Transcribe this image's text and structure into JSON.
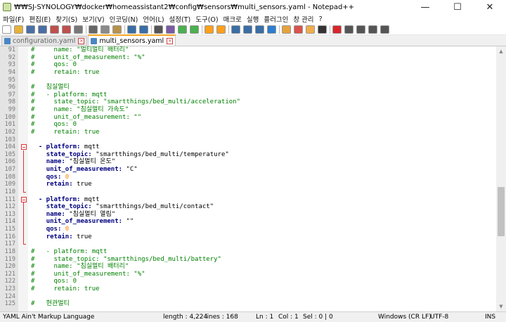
{
  "window": {
    "title": "₩₩SJ-SYNOLOGY₩docker₩homeassistant2₩config₩sensors₩multi_sensors.yaml - Notepad++",
    "minimize": "—",
    "maximize": "☐",
    "close": "✕"
  },
  "menu": [
    "파일(F)",
    "편집(E)",
    "찾기(S)",
    "보기(V)",
    "인코딩(N)",
    "언어(L)",
    "설정(T)",
    "도구(O)",
    "매크로",
    "실행",
    "플러그인",
    "창 관리",
    "?"
  ],
  "toolbar_icons": [
    {
      "name": "new-file-icon",
      "color": "#ffffff"
    },
    {
      "name": "open-file-icon",
      "color": "#e7b23a"
    },
    {
      "name": "save-icon",
      "color": "#4a6fa5"
    },
    {
      "name": "save-all-icon",
      "color": "#4a6fa5"
    },
    {
      "name": "close-icon",
      "color": "#c0504d"
    },
    {
      "name": "close-all-icon",
      "color": "#c0504d"
    },
    {
      "name": "print-icon",
      "color": "#777777"
    },
    {
      "name": "cut-icon",
      "color": "#666666"
    },
    {
      "name": "copy-icon",
      "color": "#8a8a8a"
    },
    {
      "name": "paste-icon",
      "color": "#b8924a"
    },
    {
      "name": "undo-icon",
      "color": "#3a6ea5"
    },
    {
      "name": "redo-icon",
      "color": "#3a6ea5"
    },
    {
      "name": "find-icon",
      "color": "#555555"
    },
    {
      "name": "replace-icon",
      "color": "#7a5aa5"
    },
    {
      "name": "zoom-in-icon",
      "color": "#4caf50"
    },
    {
      "name": "zoom-out-icon",
      "color": "#4caf50"
    },
    {
      "name": "sync-v-icon",
      "color": "#ff9f1a"
    },
    {
      "name": "sync-h-icon",
      "color": "#ff9f1a"
    },
    {
      "name": "word-wrap-icon",
      "color": "#3a6ea5"
    },
    {
      "name": "show-all-chars-icon",
      "color": "#3a6ea5"
    },
    {
      "name": "indent-guide-icon",
      "color": "#3a6ea5"
    },
    {
      "name": "udl-icon",
      "color": "#2f7dd1"
    },
    {
      "name": "doc-map-icon",
      "color": "#e6a23c"
    },
    {
      "name": "function-list-icon",
      "color": "#d9534f"
    },
    {
      "name": "folder-workspace-icon",
      "color": "#f0ad4e"
    },
    {
      "name": "monitor-icon",
      "color": "#333333"
    },
    {
      "name": "record-macro-icon",
      "color": "#d9252a"
    },
    {
      "name": "stop-macro-icon",
      "color": "#555555"
    },
    {
      "name": "play-macro-icon",
      "color": "#555555"
    },
    {
      "name": "play-multi-icon",
      "color": "#555555"
    },
    {
      "name": "save-macro-icon",
      "color": "#555555"
    }
  ],
  "tabs": [
    {
      "label": "configuration.yaml",
      "active": false,
      "save_color": "#4a86c5"
    },
    {
      "label": "multi_sensors.yaml",
      "active": true,
      "save_color": "#4a86c5"
    }
  ],
  "editor": {
    "lines": [
      {
        "n": "91",
        "fold": "",
        "html": "<span class='cm'>#     name: \"멀티멀티 배터리\"</span>"
      },
      {
        "n": "92",
        "fold": "",
        "html": "<span class='cm'>#     unit_of_measurement: \"%\"</span>"
      },
      {
        "n": "93",
        "fold": "",
        "html": "<span class='cm'>#     qos: 0</span>"
      },
      {
        "n": "94",
        "fold": "",
        "html": "<span class='cm'>#     retain: true</span>"
      },
      {
        "n": "95",
        "fold": "",
        "html": ""
      },
      {
        "n": "96",
        "fold": "",
        "html": "<span class='cm'>#   침실멀티</span>"
      },
      {
        "n": "97",
        "fold": "",
        "html": "<span class='cm'>#   - platform: mqtt</span>"
      },
      {
        "n": "98",
        "fold": "",
        "html": "<span class='cm'>#     state_topic: \"smartthings/bed_multi/acceleration\"</span>"
      },
      {
        "n": "99",
        "fold": "",
        "html": "<span class='cm'>#     name: \"침실멀티 가속도\"</span>"
      },
      {
        "n": "100",
        "fold": "",
        "html": "<span class='cm'>#     unit_of_measurement: \"\"</span>"
      },
      {
        "n": "101",
        "fold": "",
        "html": "<span class='cm'>#     qos: 0</span>"
      },
      {
        "n": "102",
        "fold": "",
        "html": "<span class='cm'>#     retain: true</span>"
      },
      {
        "n": "103",
        "fold": "",
        "html": ""
      },
      {
        "n": "104",
        "fold": "box",
        "html": "  <span class='ky'>- platform:</span> <span class='st'>mqtt</span>"
      },
      {
        "n": "105",
        "fold": "bar",
        "html": "    <span class='ky'>state_topic:</span> <span class='st'>\"smartthings/bed_multi/temperature\"</span>"
      },
      {
        "n": "106",
        "fold": "bar",
        "html": "    <span class='ky'>name:</span> <span class='st'>\"침실멀티 온도\"</span>"
      },
      {
        "n": "107",
        "fold": "bar",
        "html": "    <span class='ky'>unit_of_measurement:</span> <span class='st'>\"C\"</span>"
      },
      {
        "n": "108",
        "fold": "bar",
        "html": "    <span class='ky'>qos:</span> <span class='nm'>0</span>"
      },
      {
        "n": "109",
        "fold": "bar",
        "html": "    <span class='ky'>retain:</span> <span class='st'>true</span>"
      },
      {
        "n": "110",
        "fold": "end",
        "html": ""
      },
      {
        "n": "111",
        "fold": "box",
        "html": "  <span class='ky'>- platform:</span> <span class='st'>mqtt</span>"
      },
      {
        "n": "112",
        "fold": "bar",
        "html": "    <span class='ky'>state_topic:</span> <span class='st'>\"smartthings/bed_multi/contact\"</span>"
      },
      {
        "n": "113",
        "fold": "bar",
        "html": "    <span class='ky'>name:</span> <span class='st'>\"침실멀티 열림\"</span>"
      },
      {
        "n": "114",
        "fold": "bar",
        "html": "    <span class='ky'>unit_of_measurement:</span> <span class='st'>\"\"</span>"
      },
      {
        "n": "115",
        "fold": "bar",
        "html": "    <span class='ky'>qos:</span> <span class='nm'>0</span>"
      },
      {
        "n": "116",
        "fold": "bar",
        "html": "    <span class='ky'>retain:</span> <span class='st'>true</span>"
      },
      {
        "n": "117",
        "fold": "end",
        "html": ""
      },
      {
        "n": "118",
        "fold": "",
        "html": "<span class='cm'>#   - platform: mqtt</span>"
      },
      {
        "n": "119",
        "fold": "",
        "html": "<span class='cm'>#     state_topic: \"smartthings/bed_multi/battery\"</span>"
      },
      {
        "n": "120",
        "fold": "",
        "html": "<span class='cm'>#     name: \"침실멀티 배터리\"</span>"
      },
      {
        "n": "121",
        "fold": "",
        "html": "<span class='cm'>#     unit_of_measurement: \"%\"</span>"
      },
      {
        "n": "122",
        "fold": "",
        "html": "<span class='cm'>#     qos: 0</span>"
      },
      {
        "n": "123",
        "fold": "",
        "html": "<span class='cm'>#     retain: true</span>"
      },
      {
        "n": "124",
        "fold": "",
        "html": ""
      },
      {
        "n": "125",
        "fold": "",
        "html": "<span class='cm'>#   현관멀티</span>"
      }
    ]
  },
  "status": {
    "language": "YAML Ain't Markup Language",
    "length": "length : 4,224",
    "lines": "lines : 168",
    "ln": "Ln : 1",
    "col": "Col : 1",
    "sel": "Sel : 0 | 0",
    "eol": "Windows (CR LF)",
    "encoding": "UTF-8",
    "mode": "INS"
  }
}
